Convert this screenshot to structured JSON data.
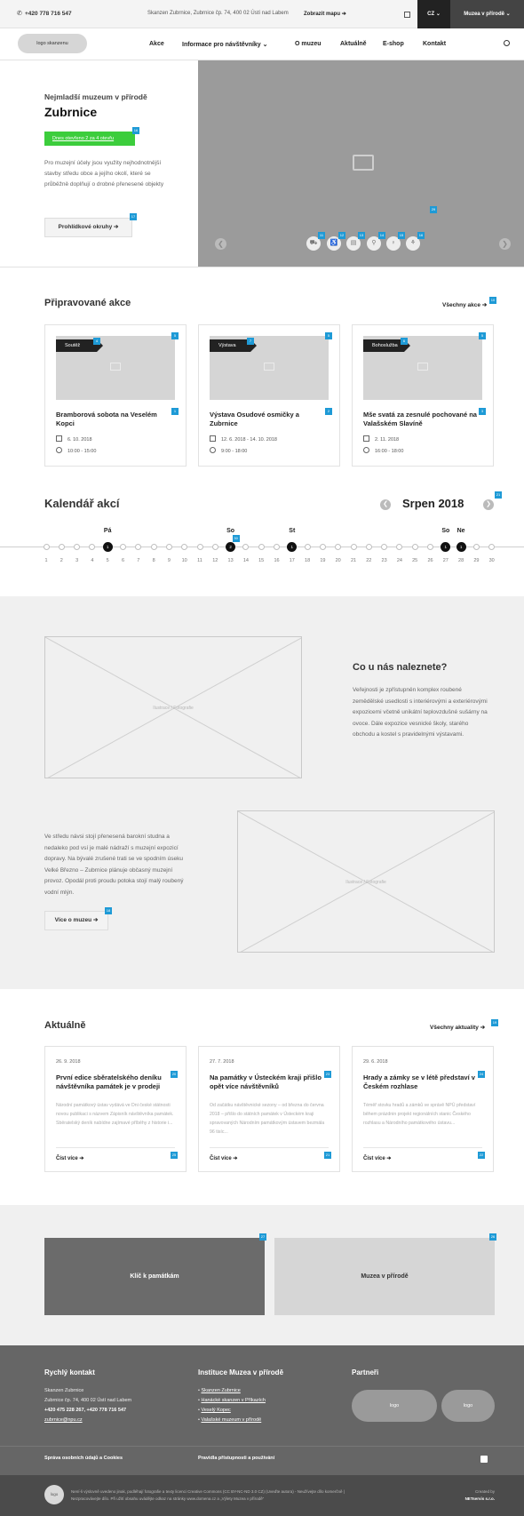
{
  "topbar": {
    "phone": "+420 778 716 547",
    "address": "Skanzen Zubrnice, Zubrnice čp. 74, 400 02 Ústí nad Labem",
    "map_link": "Zobrazit mapu",
    "lang": "CZ",
    "museums": "Muzea v přírodě"
  },
  "header": {
    "logo": "logo skanzenu",
    "nav": [
      "Akce",
      "Informace pro návštěvníky",
      "O muzeu",
      "Aktuálně",
      "E-shop",
      "Kontakt"
    ]
  },
  "hero": {
    "subtitle": "Nejmladší muzeum v přírodě",
    "title": "Zubrnice",
    "open_label": "Dnes otevřeno 2 za 4 otevřu",
    "description": "Pro muzejní účely jsou využity nejhodnotnější stavby středu obce a jejího okolí, které se průběžně doplňují o drobné přenesené objekty",
    "button": "Prohlídkové okruhy",
    "badges": [
      "16",
      "17",
      "29",
      "11",
      "12",
      "13",
      "14",
      "15",
      "16"
    ]
  },
  "events": {
    "title": "Připravované akce",
    "all_link": "Všechny akce",
    "all_badge": "10",
    "items": [
      {
        "tag": "Soutěž",
        "title": "Bramborová sobota na Veselém Kopci",
        "date": "6. 10. 2018",
        "time": "10:00 - 15:00",
        "tag_badge": "4",
        "img_badge": "5",
        "title_badge": "1"
      },
      {
        "tag": "Výstava",
        "title": "Výstava Osudové osmičky a Zubrnice",
        "date": "12. 6. 2018 - 14. 10. 2018",
        "time": "9:00 - 18:00",
        "tag_badge": "7",
        "img_badge": "5",
        "title_badge": "2"
      },
      {
        "tag": "Bohoslužba",
        "title": "Mše svatá za zesnulé pochované na Valašském Slavíně",
        "date": "2. 11. 2018",
        "time": "16:00 - 18:00",
        "tag_badge": "6",
        "img_badge": "5",
        "title_badge": "3"
      }
    ]
  },
  "calendar": {
    "title": "Kalendář akcí",
    "month": "Srpen 2018",
    "month_badge": "21",
    "days": [
      "1",
      "2",
      "3",
      "4",
      "5",
      "6",
      "7",
      "8",
      "9",
      "10",
      "11",
      "12",
      "13",
      "14",
      "15",
      "16",
      "17",
      "18",
      "19",
      "20",
      "21",
      "22",
      "23",
      "24",
      "25",
      "26",
      "27",
      "28",
      "29",
      "30"
    ],
    "event_days": [
      {
        "day": "5",
        "weekday": "Pá",
        "count": "1"
      },
      {
        "day": "13",
        "weekday": "So",
        "count": "2"
      },
      {
        "day": "17",
        "weekday": "St",
        "count": "1"
      },
      {
        "day": "27",
        "weekday": "So",
        "count": "1"
      },
      {
        "day": "28",
        "weekday": "Ne",
        "count": "1"
      }
    ],
    "marker_badge": "30"
  },
  "about": {
    "heading": "Co u nás naleznete?",
    "text1": "Veřejnosti je zpřístupněn komplex roubené zemědělské usedlosti s interiérovými a exteriérovými expozicemi včetně unikátní teplovzdušné sušárny na ovoce. Dále expozice vesnické školy, starého obchodu a kostel s pravidelnými výstavami.",
    "text2": "Ve středu návsi stojí přenesená barokní studna a nedaleko pod vsí je malé nádraží s muzejní expozicí dopravy. Na bývalé zrušené trati se ve spodním úseku Velké Březno – Zubrnice plánuje občasný muzejní provoz. Opodál proti proudu potoka stojí malý roubený vodní mlýn.",
    "image_label": "Ilustrace / Fotografie",
    "button": "Více o muzeu",
    "button_badge": "18"
  },
  "news": {
    "title": "Aktuálně",
    "all_link": "Všechny aktuality",
    "all_badge": "19",
    "items": [
      {
        "date": "26. 9. 2018",
        "title": "První edice sběratelského deníku návštěvníka památek je v prodeji",
        "text": "Národní památkový ústav vydává ve Dni české státnosti novou publikaci s názvem Zápisník návštěvníka památek. Sběratelský deník nabídne zajímavé příběhy z historie i...",
        "more": "Číst více",
        "title_badge": "20",
        "more_badge": "25"
      },
      {
        "date": "27. 7. 2018",
        "title": "Na památky v Ústeckém kraji přišlo opět více návštěvníků",
        "text": "Od začátku návštěvnické sezony – od března do června 2018 – přišlo do státních památek v Ústeckém kraji spravovaných Národním památkovým ústavem bezmála 96 tisíc...",
        "more": "Číst více",
        "title_badge": "23",
        "more_badge": "21"
      },
      {
        "date": "29. 6. 2018",
        "title": "Hrady a zámky se v létě představí v Českém rozhlase",
        "text": "Téměř stovku hradů a zámků ve správě NPÚ představí během prázdnin projekt regionálních stanic Českého rozhlasu a Národního památkového ústavu...",
        "more": "Číst více",
        "title_badge": "24",
        "more_badge": "22"
      }
    ]
  },
  "promo": [
    {
      "label": "Klíč k památkám",
      "badge": "27"
    },
    {
      "label": "Muzea v přírodě",
      "badge": "26"
    }
  ],
  "footer": {
    "contact_title": "Rychlý kontakt",
    "contact_lines": [
      "Skanzen Zubrnice",
      "Zubrnice čp. 74, 400 02 Ústí nad Labem"
    ],
    "contact_phones": "+420 475 228 267, +420 778 716 547",
    "contact_email": "zubrnice@npu.cz",
    "institutions_title": "Instituce Muzea v přírodě",
    "institutions": [
      "Skanzen Zubrnice",
      "Hanácké skanzen v Příkazích",
      "Veselý Kopec",
      "Valašské muzeum v přírodě"
    ],
    "partners_title": "Partneři",
    "partners": [
      "logo",
      "logo"
    ],
    "privacy": "Správa osobních údajů a Cookies",
    "accessibility": "Pravidla přístupnosti a používání"
  },
  "legal": {
    "logo": "logo",
    "text": "Není-li výslovně uvedeno jinak, podléhají fotografie a texty licenci Creative Commons (CC BY-NC-ND 3.0 CZ) (Uveďte autora) - Neužívejte dílo komerčně | Nezpracovávejte dílo. Při užití obsahu uvádějte odkaz na stránky www.domena.cz a „Výlety Muzea v přírodě“",
    "created_by": "Created by",
    "created_company": "NETservis s.r.o."
  },
  "colors": {
    "accent_badge": "#1e9ad6",
    "open_green": "#3ccd3c",
    "slider_gray": "#9b9b9b",
    "footer_gray": "#666666"
  }
}
